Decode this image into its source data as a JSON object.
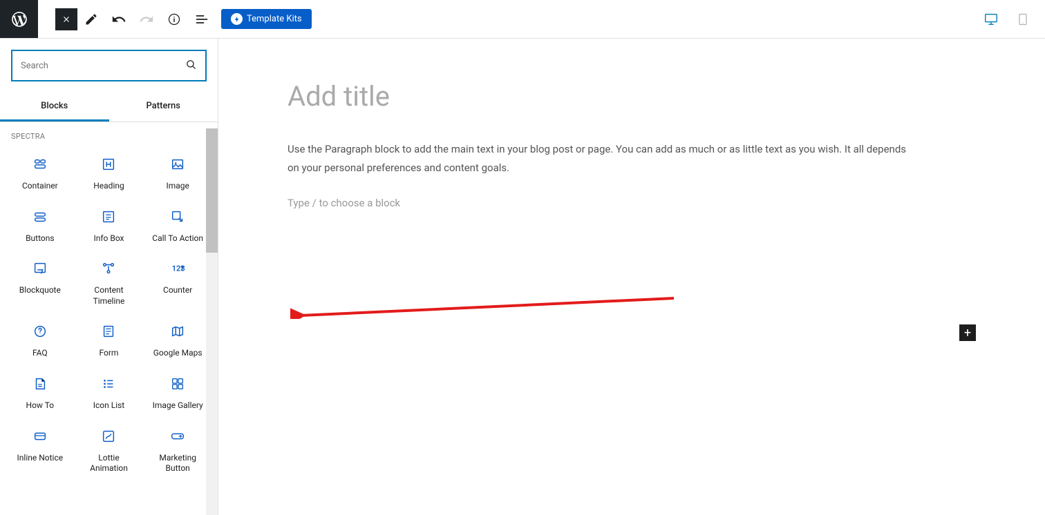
{
  "toolbar": {
    "template_kits": "Template Kits"
  },
  "sidebar": {
    "search_placeholder": "Search",
    "tabs": {
      "blocks": "Blocks",
      "patterns": "Patterns"
    },
    "group_title": "SPECTRA",
    "blocks": [
      {
        "label": "Container",
        "icon": "container"
      },
      {
        "label": "Heading",
        "icon": "heading"
      },
      {
        "label": "Image",
        "icon": "image"
      },
      {
        "label": "Buttons",
        "icon": "buttons"
      },
      {
        "label": "Info Box",
        "icon": "infobox"
      },
      {
        "label": "Call To Action",
        "icon": "cta"
      },
      {
        "label": "Blockquote",
        "icon": "blockquote"
      },
      {
        "label": "Content Timeline",
        "icon": "timeline"
      },
      {
        "label": "Counter",
        "icon": "counter"
      },
      {
        "label": "FAQ",
        "icon": "faq"
      },
      {
        "label": "Form",
        "icon": "form"
      },
      {
        "label": "Google Maps",
        "icon": "maps"
      },
      {
        "label": "How To",
        "icon": "howto"
      },
      {
        "label": "Icon List",
        "icon": "iconlist"
      },
      {
        "label": "Image Gallery",
        "icon": "gallery"
      },
      {
        "label": "Inline Notice",
        "icon": "notice"
      },
      {
        "label": "Lottie Animation",
        "icon": "lottie"
      },
      {
        "label": "Marketing Button",
        "icon": "mbutton"
      }
    ]
  },
  "canvas": {
    "title": "Add title",
    "paragraph": "Use the Paragraph block to add the main text in your blog post or page. You can add as much or as little text as you wish. It all depends on your personal preferences and content goals.",
    "choose": "Type / to choose a block"
  }
}
